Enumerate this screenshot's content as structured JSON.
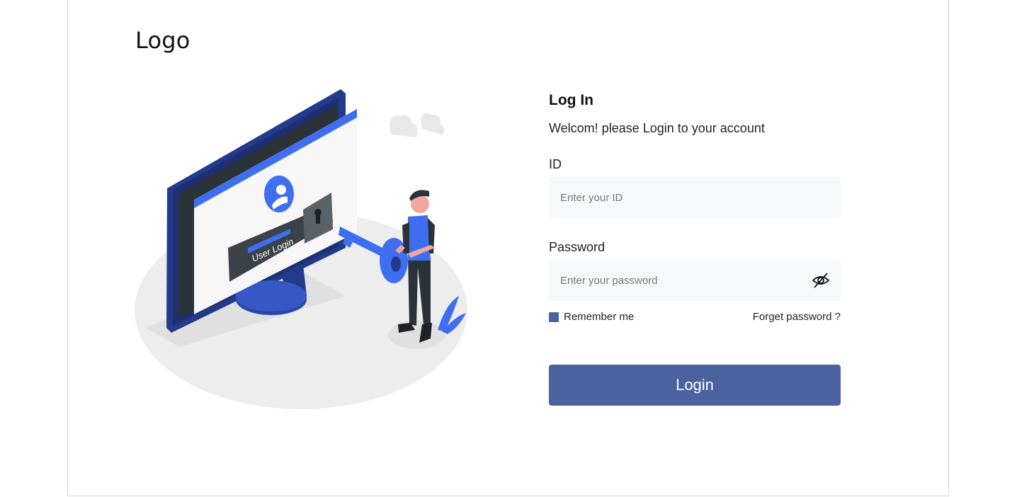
{
  "header": {
    "logo_text": "Logo"
  },
  "illustration": {
    "screen_label": "User Login",
    "colors": {
      "primary_blue": "#3f6ff0",
      "dark_navy": "#243a8a",
      "gray_platform": "#ededed"
    }
  },
  "login": {
    "title": "Log In",
    "subtitle": "Welcom! please Login to your account",
    "id_label": "ID",
    "id_placeholder": "Enter your ID",
    "password_label": "Password",
    "password_placeholder": "Enter your password",
    "toggle_visibility_icon": "eye-off-icon",
    "remember_label": "Remember me",
    "remember_checked": true,
    "forgot_label": "Forget password ?",
    "submit_label": "Login",
    "accent_color": "#4a63a0"
  }
}
